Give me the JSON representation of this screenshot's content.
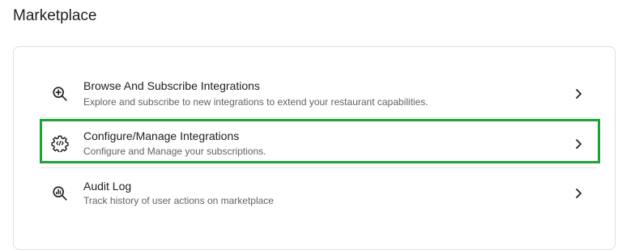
{
  "header": {
    "title": "Marketplace"
  },
  "items": [
    {
      "title": "Browse And Subscribe Integrations",
      "description": "Explore and subscribe to new integrations to extend your restaurant capabilities.",
      "icon": "zoom-in-icon"
    },
    {
      "title": "Configure/Manage Integrations",
      "description": "Configure and Manage your subscriptions.",
      "icon": "gear-code-icon",
      "highlighted": true
    },
    {
      "title": "Audit Log",
      "description": "Track history of user actions on marketplace",
      "icon": "search-analytics-icon"
    }
  ],
  "colors": {
    "highlight": "#1ea33a",
    "text_primary": "#202124",
    "text_secondary": "#5f6368"
  }
}
